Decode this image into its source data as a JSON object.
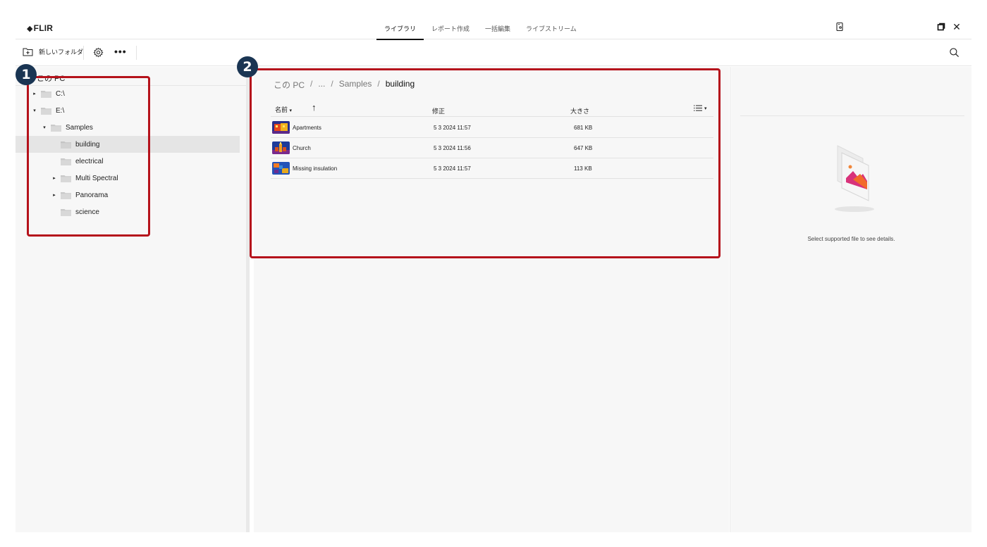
{
  "app": {
    "logo": "FLIR",
    "tabs": [
      {
        "label": "ライブラリ",
        "active": true
      },
      {
        "label": "レポート作成",
        "active": false
      },
      {
        "label": "一括編集",
        "active": false
      },
      {
        "label": "ライブストリーム",
        "active": false
      }
    ],
    "icons": {
      "device": "device-icon",
      "restore": "restore-icon",
      "close": "close-icon",
      "close_glyph": "✕"
    }
  },
  "toolbar": {
    "new_folder_label": "新しいフォルダ",
    "more_glyph": "•••"
  },
  "tree": {
    "root_label": "この PC",
    "items": [
      {
        "label": "C:\\",
        "caret": "▸"
      },
      {
        "label": "E:\\",
        "caret": "▾"
      },
      {
        "label": "Samples",
        "caret": "▾"
      },
      {
        "label": "building",
        "caret": "",
        "selected": true
      },
      {
        "label": "electrical",
        "caret": ""
      },
      {
        "label": "Multi Spectral",
        "caret": "▸"
      },
      {
        "label": "Panorama",
        "caret": "▸"
      },
      {
        "label": "science",
        "caret": ""
      }
    ]
  },
  "breadcrumb": {
    "root": "この PC",
    "ellipsis": "...",
    "parent": "Samples",
    "current": "building",
    "separator": "/"
  },
  "file_table": {
    "headers": {
      "name": "名前",
      "name_caret": "▾",
      "sort_glyph": "↑",
      "modified": "修正",
      "size": "大きさ",
      "view_caret": "▾"
    },
    "rows": [
      {
        "name": "Apartments",
        "modified": "5 3 2024 11:57",
        "size": "681 KB"
      },
      {
        "name": "Church",
        "modified": "5 3 2024 11:56",
        "size": "647 KB"
      },
      {
        "name": "Missing insulation",
        "modified": "5 3 2024 11:57",
        "size": "113 KB"
      }
    ]
  },
  "details": {
    "placeholder_text": "Select supported file to see details."
  },
  "annotations": {
    "badge_1": "1",
    "badge_2": "2",
    "color": "#b5121b",
    "badge_color": "#1a3553"
  }
}
